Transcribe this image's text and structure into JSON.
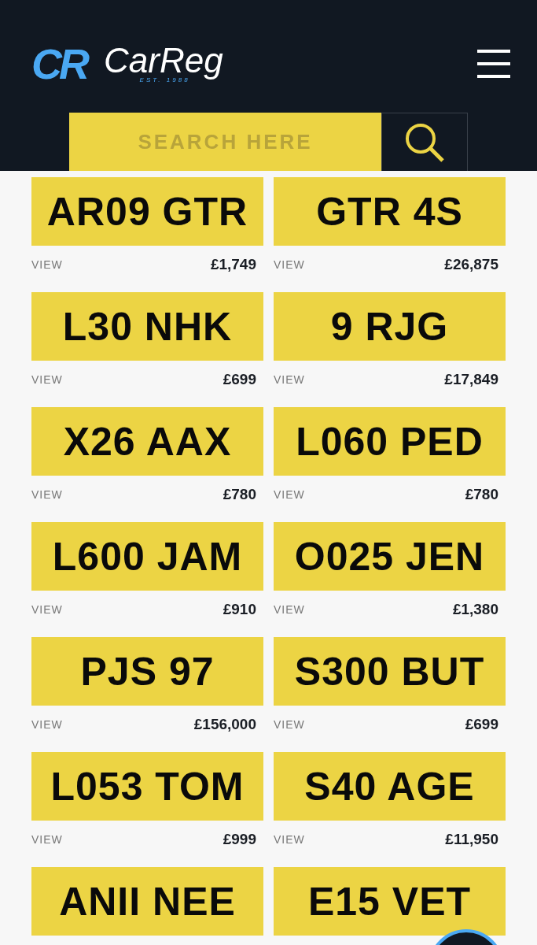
{
  "header": {
    "logo_mark": "CR",
    "brand": "CarReg",
    "tagline": "EST. 1988"
  },
  "search": {
    "placeholder": "SEARCH HERE"
  },
  "listings": [
    {
      "plate": "AR09 GTR",
      "link": "VIEW",
      "price": "£1,749"
    },
    {
      "plate": "GTR 4S",
      "link": "VIEW",
      "price": "£26,875"
    },
    {
      "plate": "L30 NHK",
      "link": "VIEW",
      "price": "£699"
    },
    {
      "plate": "9 RJG",
      "link": "VIEW",
      "price": "£17,849"
    },
    {
      "plate": "X26 AAX",
      "link": "VIEW",
      "price": "£780"
    },
    {
      "plate": "L060 PED",
      "link": "VIEW",
      "price": "£780"
    },
    {
      "plate": "L600 JAM",
      "link": "VIEW",
      "price": "£910"
    },
    {
      "plate": "O025 JEN",
      "link": "VIEW",
      "price": "£1,380"
    },
    {
      "plate": "PJS 97",
      "link": "VIEW",
      "price": "£156,000"
    },
    {
      "plate": "S300 BUT",
      "link": "VIEW",
      "price": "£699"
    },
    {
      "plate": "L053 TOM",
      "link": "VIEW",
      "price": "£999"
    },
    {
      "plate": "S40 AGE",
      "link": "VIEW",
      "price": "£11,950"
    },
    {
      "plate": "ANII NEE"
    },
    {
      "plate": "E15 VET"
    }
  ]
}
